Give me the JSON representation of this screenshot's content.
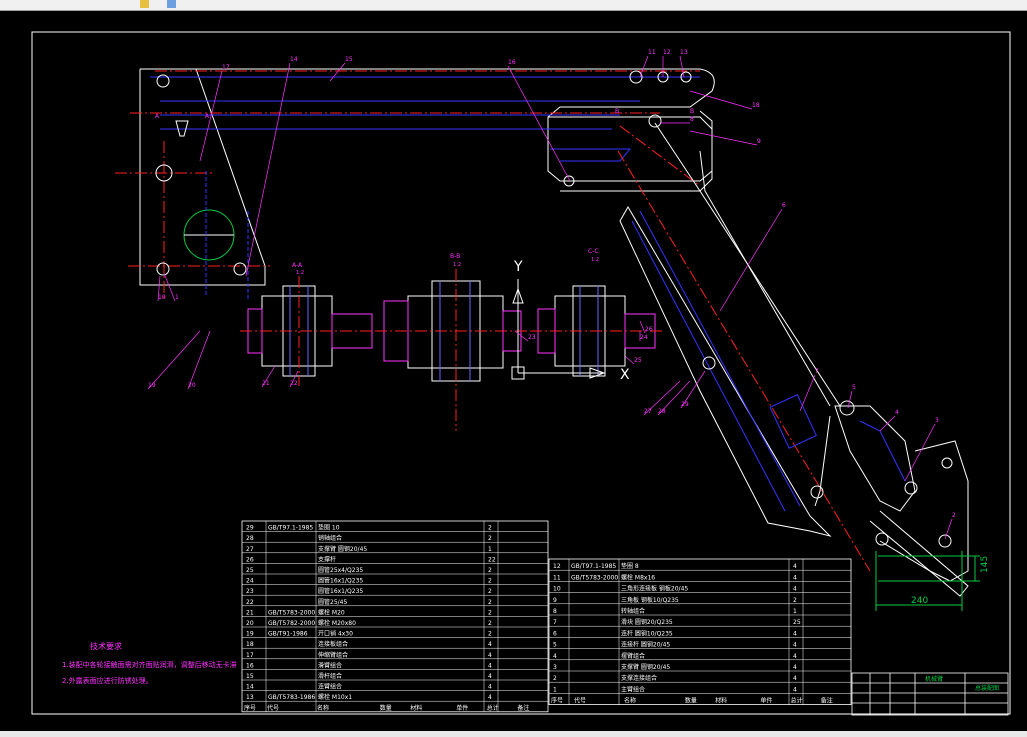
{
  "colors": {
    "background": "#000000",
    "outline": "#ffffff",
    "hidden_line": "#3333ff",
    "center_line": "#ff2020",
    "leader": "#ff33ff",
    "dimension": "#00cc44",
    "hatch": "#6666ff"
  },
  "toolbar": {
    "icons": [
      "folder-icon",
      "cube-icon"
    ]
  },
  "drawing": {
    "views": [
      {
        "id": "A-A",
        "title": "A-A",
        "scale": "1:2"
      },
      {
        "id": "B-B",
        "title": "B-B",
        "scale": "1:2"
      },
      {
        "id": "C-C",
        "title": "C-C",
        "scale": "1:2"
      }
    ],
    "section_marks": [
      "A",
      "A",
      "B",
      "B"
    ],
    "axes": {
      "y": "Y",
      "x": "X"
    },
    "dimensions": [
      "240",
      "145"
    ],
    "balloons": [
      "17",
      "14",
      "15",
      "16",
      "11",
      "12",
      "13",
      "18",
      "8",
      "9",
      "6",
      "7",
      "5",
      "4",
      "3",
      "2",
      "1",
      "10",
      "19",
      "20",
      "21",
      "22",
      "23",
      "24",
      "25",
      "26",
      "27",
      "28",
      "29"
    ]
  },
  "notes": {
    "title": "技术要求",
    "lines": [
      "1.装配中各轮接触面需对齐面贴润滑，调整后移动无卡滞",
      "2.外露表面应进行防锈处理。"
    ]
  },
  "bom_left": [
    {
      "no": "29",
      "code": "GB/T97.1-1985",
      "name": "垫圈 10",
      "qty": "2"
    },
    {
      "no": "28",
      "code": "",
      "name": "销轴组合",
      "qty": "2"
    },
    {
      "no": "27",
      "code": "",
      "name": "支撑臂 圆钢20/45",
      "qty": "1"
    },
    {
      "no": "26",
      "code": "",
      "name": "支撑杆",
      "qty": "22"
    },
    {
      "no": "25",
      "code": "",
      "name": "圆管25x4/Q235",
      "qty": "2"
    },
    {
      "no": "24",
      "code": "",
      "name": "圆管16x1/Q235",
      "qty": "2"
    },
    {
      "no": "23",
      "code": "",
      "name": "圆管16x1/Q235",
      "qty": "2"
    },
    {
      "no": "22",
      "code": "",
      "name": "圆管25/45",
      "qty": "2"
    },
    {
      "no": "21",
      "code": "GB/T5783-2000",
      "name": "螺栓 M20",
      "qty": "2"
    },
    {
      "no": "20",
      "code": "GB/T5782-2000",
      "name": "螺栓 M20x80",
      "qty": "2"
    },
    {
      "no": "19",
      "code": "GB/T91-1986",
      "name": "开口销 4x30",
      "qty": "2"
    },
    {
      "no": "18",
      "code": "",
      "name": "连接板组合",
      "qty": "4"
    },
    {
      "no": "17",
      "code": "",
      "name": "伸缩臂组合",
      "qty": "4"
    },
    {
      "no": "16",
      "code": "",
      "name": "滑臂组合",
      "qty": "4"
    },
    {
      "no": "15",
      "code": "",
      "name": "滑杆组合",
      "qty": "4"
    },
    {
      "no": "14",
      "code": "",
      "name": "连臂组合",
      "qty": "4"
    },
    {
      "no": "13",
      "code": "GB/T5783-1986",
      "name": "螺栓 M10x1",
      "qty": "4"
    }
  ],
  "bom_right": [
    {
      "no": "12",
      "code": "GB/T97.1-1985",
      "name": "垫圈 8",
      "qty": "4"
    },
    {
      "no": "11",
      "code": "GB/T5783-2000",
      "name": "螺栓 M8x16",
      "qty": "4"
    },
    {
      "no": "10",
      "code": "",
      "name": "三角形连接板 钢板20/45",
      "qty": "4"
    },
    {
      "no": "9",
      "code": "",
      "name": "三角板 钢板10/Q235",
      "qty": "2"
    },
    {
      "no": "8",
      "code": "",
      "name": "转轴组合",
      "qty": "1"
    },
    {
      "no": "7",
      "code": "",
      "name": "滑块 圆钢20/Q235",
      "qty": "25"
    },
    {
      "no": "6",
      "code": "",
      "name": "连杆 圆钢10/Q235",
      "qty": "4"
    },
    {
      "no": "5",
      "code": "",
      "name": "连接杆 圆钢20/45",
      "qty": "4"
    },
    {
      "no": "4",
      "code": "",
      "name": "摆臂组合",
      "qty": "4"
    },
    {
      "no": "3",
      "code": "",
      "name": "支撑臂 圆钢20/45",
      "qty": "4"
    },
    {
      "no": "2",
      "code": "",
      "name": "支撑连接组合",
      "qty": "4"
    },
    {
      "no": "1",
      "code": "",
      "name": "主臂组合",
      "qty": "4"
    }
  ],
  "bom_header": [
    "序号",
    "代号",
    "名称",
    "数量",
    "材料",
    "单件",
    "总计",
    "备注"
  ],
  "title_block": {
    "name": "机械臂",
    "drawing_no": "总装配图"
  }
}
